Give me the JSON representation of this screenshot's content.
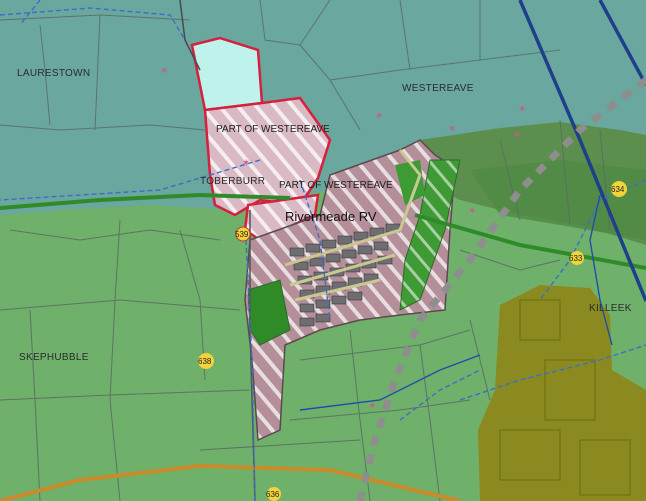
{
  "map": {
    "townlands": [
      {
        "name": "LAURESTOWN"
      },
      {
        "name": "WESTEREAVE"
      },
      {
        "name": "SKEPHUBBLE"
      },
      {
        "name": "KILLEEK"
      },
      {
        "name": "TOBERBURR"
      }
    ],
    "sites": [
      {
        "name": "PART OF WESTEREAVE"
      },
      {
        "name": "PART OF WESTEREAVE"
      },
      {
        "name": "Rivermeade RV"
      }
    ],
    "road_markers": [
      "539",
      "634",
      "633",
      "638",
      "636"
    ],
    "colors": {
      "teal_zone": "#6aa79e",
      "green_zone": "#6fb06a",
      "dark_green": "#2f8a28",
      "olive": "#8a8a20",
      "hatched": "#b48f9a",
      "boundary_red": "#d4213e",
      "cyan": "#c0f2ec",
      "marker": "#f2d43a",
      "boundary_blue": "#1f4fa8",
      "green_line": "#2f8a28"
    }
  }
}
